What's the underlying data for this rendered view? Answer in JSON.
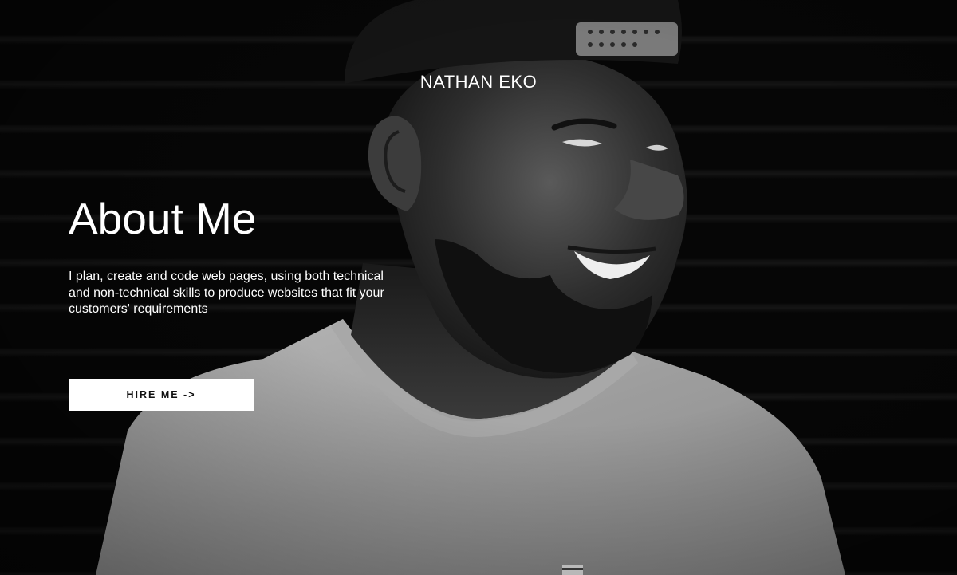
{
  "header": {
    "brand_name": "NATHAN EKO"
  },
  "hero": {
    "title": "About Me",
    "description": "I plan, create and code web pages, using both technical and non-technical skills to produce websites that fit your customers' requirements",
    "cta_label": "HIRE ME ->",
    "photo_alt": "Black and white portrait of a smiling man wearing a backwards cap and grey t-shirt"
  },
  "colors": {
    "background": "#050505",
    "text": "#ffffff",
    "button_bg": "#ffffff",
    "button_text": "#111111"
  }
}
